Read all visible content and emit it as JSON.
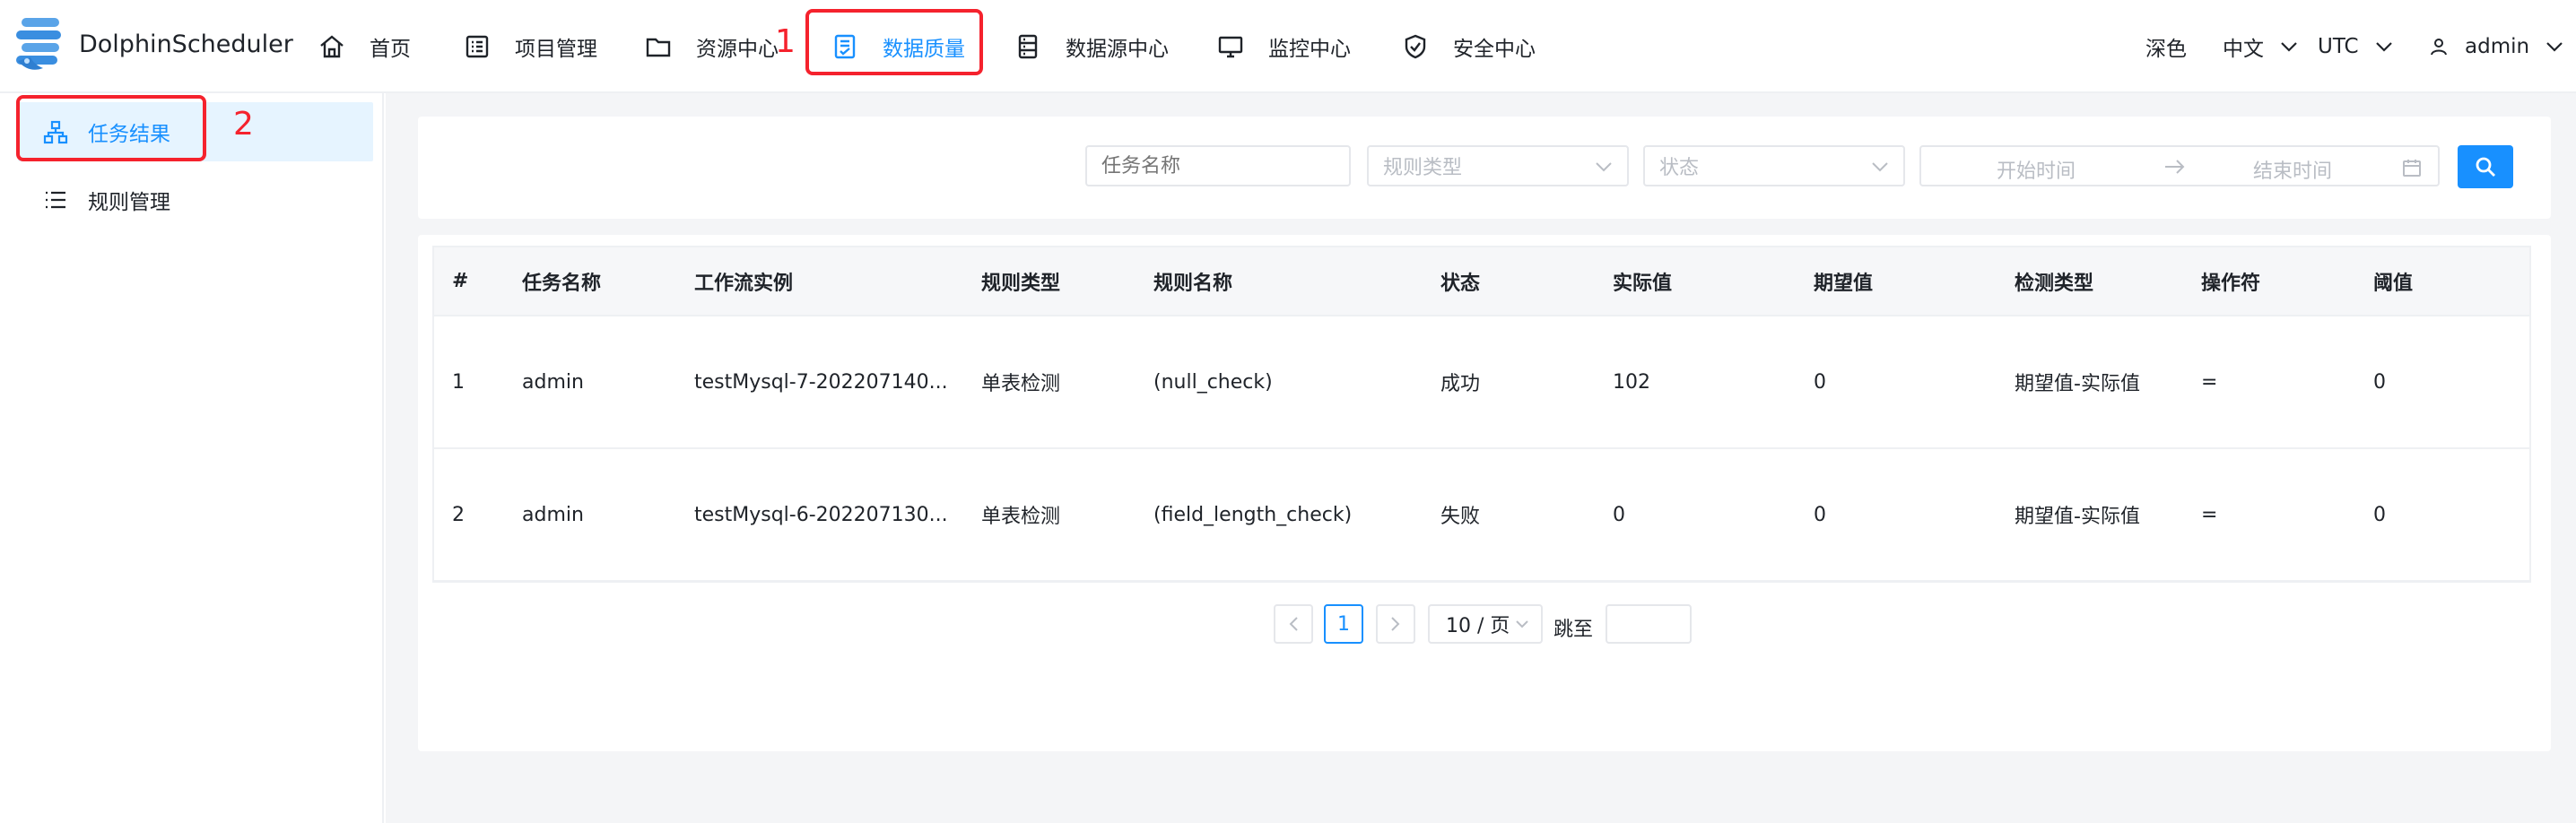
{
  "app": {
    "brand": "DolphinScheduler"
  },
  "nav": {
    "home": "首页",
    "projects": "项目管理",
    "resources": "资源中心",
    "data_quality": "数据质量",
    "datasource": "数据源中心",
    "monitor": "监控中心",
    "security": "安全中心"
  },
  "header_right": {
    "theme": "深色",
    "language": "中文",
    "timezone": "UTC",
    "user": "admin"
  },
  "annotations": {
    "label1": "1",
    "label2": "2",
    "color": "#f5222d"
  },
  "sidebar": {
    "items": [
      {
        "label": "任务结果",
        "active": true
      },
      {
        "label": "规则管理",
        "active": false
      }
    ]
  },
  "filters": {
    "task_name_placeholder": "任务名称",
    "rule_type_placeholder": "规则类型",
    "state_placeholder": "状态",
    "start_time_placeholder": "开始时间",
    "end_time_placeholder": "结束时间"
  },
  "table": {
    "headers": [
      "#",
      "任务名称",
      "工作流实例",
      "规则类型",
      "规则名称",
      "状态",
      "实际值",
      "期望值",
      "检测类型",
      "操作符",
      "阈值"
    ],
    "rows": [
      [
        "1",
        "admin",
        "testMysql-7-202207140...",
        "单表检测",
        "(null_check)",
        "成功",
        "102",
        "0",
        "期望值-实际值",
        "=",
        "0"
      ],
      [
        "2",
        "admin",
        "testMysql-6-202207130...",
        "单表检测",
        "(field_length_check)",
        "失败",
        "0",
        "0",
        "期望值-实际值",
        "=",
        "0"
      ]
    ]
  },
  "pagination": {
    "current_page": "1",
    "page_size": "10 / 页",
    "goto_label": "跳至"
  },
  "colors": {
    "accent": "#1890ff",
    "active_bg": "#e6f4ff",
    "main_bg": "#f4f5f7"
  }
}
